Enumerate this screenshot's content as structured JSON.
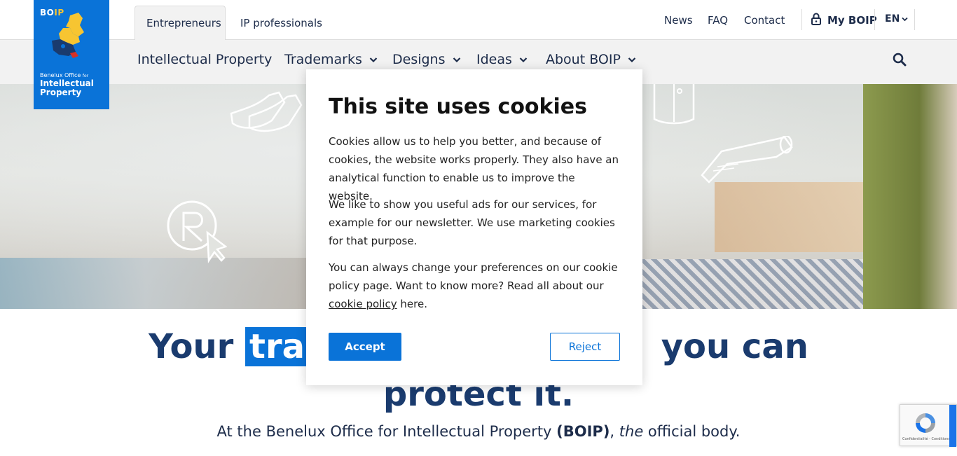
{
  "logo": {
    "short_prefix": "BO",
    "short_suffix": "IP",
    "line1": "Benelux Office",
    "line1_small": "for",
    "line2": "Intellectual",
    "line3": "Property"
  },
  "audience_tabs": [
    {
      "label": "Entrepreneurs",
      "active": true
    },
    {
      "label": "IP professionals",
      "active": false
    }
  ],
  "top_links": {
    "news": "News",
    "faq": "FAQ",
    "contact": "Contact",
    "my_boip": "My BOIP",
    "language": "EN"
  },
  "main_nav": [
    {
      "label": "Intellectual Property",
      "has_dropdown": false
    },
    {
      "label": "Trademarks",
      "has_dropdown": true
    },
    {
      "label": "Designs",
      "has_dropdown": true
    },
    {
      "label": "Ideas",
      "has_dropdown": true
    },
    {
      "label": "About BOIP",
      "has_dropdown": true
    }
  ],
  "hero": {
    "headline_start": "Your ",
    "headline_highlight": "tra",
    "headline_end": " you can",
    "headline_line2": "protect it.",
    "lead_start": "At the Benelux Office for Intellectual Property ",
    "lead_bold": "(BOIP)",
    "lead_comma": ", ",
    "lead_italic": "the",
    "lead_end": " official body."
  },
  "cookie_modal": {
    "title": "This site uses cookies",
    "paragraph1": "Cookies allow us to help you better, and because of cookies, the website works properly. They also have an analytical function to enable us to improve the website.",
    "paragraph2": "We like to show you useful ads for our services, for example for our newsletter. We use marketing cookies for that purpose.",
    "paragraph3_start": "You can always change your preferences on our cookie policy page. Want to know more? Read all about our ",
    "paragraph3_link": "cookie policy",
    "paragraph3_end": " here.",
    "accept_label": "Accept",
    "reject_label": "Reject"
  },
  "recaptcha": {
    "footer": "Confidentialité - Conditions"
  },
  "colors": {
    "brand_blue": "#0a73d8",
    "navy": "#1a3b6e",
    "nav_bg": "#f2f2f2"
  }
}
